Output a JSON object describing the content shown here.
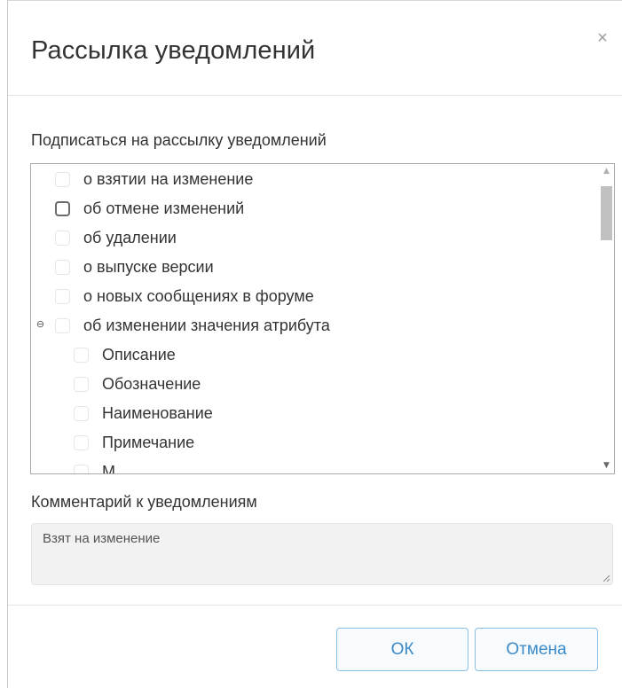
{
  "dialog": {
    "title": "Рассылка уведомлений",
    "close_symbol": "×"
  },
  "subscribe": {
    "label": "Подписаться на рассылку уведомлений",
    "items": [
      {
        "label": "о взятии на изменение",
        "level": 0,
        "checked": false,
        "focused": false
      },
      {
        "label": "об отмене изменений",
        "level": 0,
        "checked": false,
        "focused": true
      },
      {
        "label": "об удалении",
        "level": 0,
        "checked": false,
        "focused": false
      },
      {
        "label": "о выпуске версии",
        "level": 0,
        "checked": false,
        "focused": false
      },
      {
        "label": "о новых сообщениях в форуме",
        "level": 0,
        "checked": false,
        "focused": false
      },
      {
        "label": "об изменении значения атрибута",
        "level": 0,
        "checked": false,
        "focused": false,
        "expanded": true
      },
      {
        "label": "Описание",
        "level": 1,
        "checked": false,
        "focused": false
      },
      {
        "label": "Обозначение",
        "level": 1,
        "checked": false,
        "focused": false
      },
      {
        "label": "Наименование",
        "level": 1,
        "checked": false,
        "focused": false
      },
      {
        "label": "Примечание",
        "level": 1,
        "checked": false,
        "focused": false
      },
      {
        "label": "М",
        "level": 1,
        "checked": false,
        "focused": false
      }
    ],
    "collapse_symbol": "⊖",
    "scroll_up_symbol": "▲",
    "scroll_down_symbol": "▼"
  },
  "comment": {
    "label": "Комментарий к уведомлениям",
    "value": "Взят на изменение"
  },
  "footer": {
    "ok_label": "ОК",
    "cancel_label": "Отмена"
  },
  "colors": {
    "button_text": "#3a8ac8",
    "button_border": "#8cbfe6",
    "comment_bg": "#f2f2f2"
  }
}
